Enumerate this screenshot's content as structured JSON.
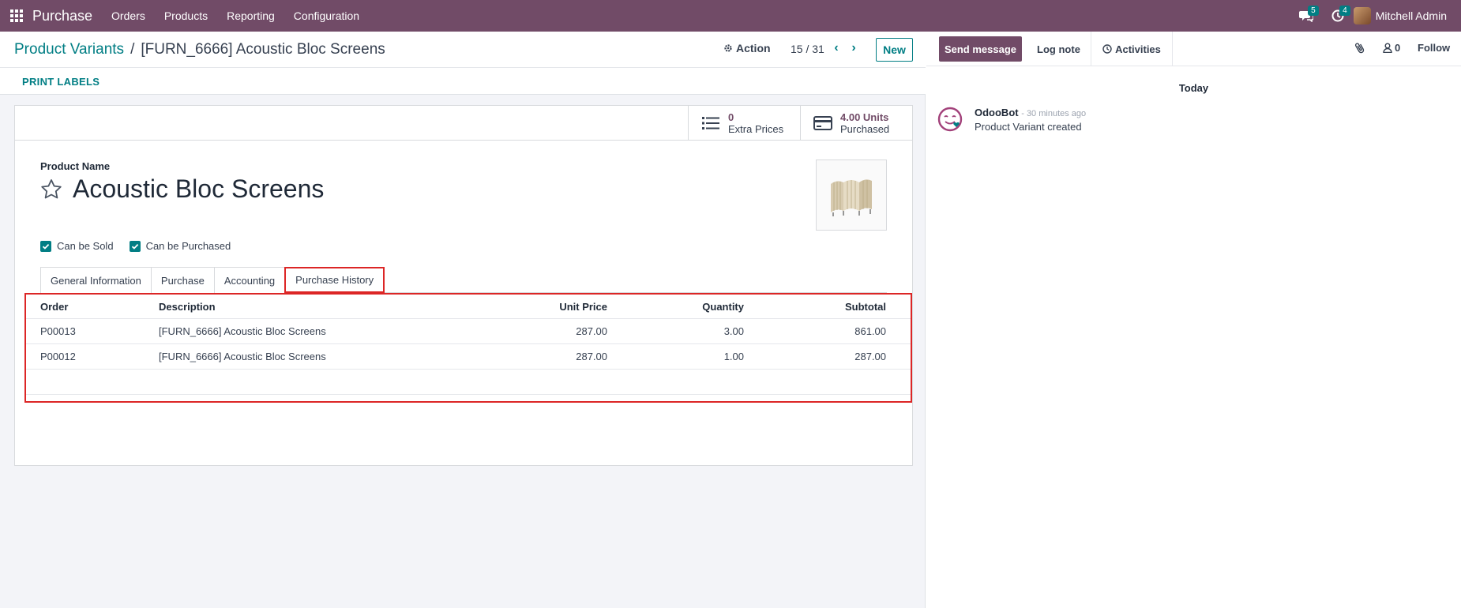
{
  "navbar": {
    "brand": "Purchase",
    "menu": [
      "Orders",
      "Products",
      "Reporting",
      "Configuration"
    ],
    "messages_count": "5",
    "activities_count": "4",
    "user": "Mitchell Admin"
  },
  "control_panel": {
    "breadcrumb_parent": "Product Variants",
    "breadcrumb_separator": "/",
    "breadcrumb_current": "[FURN_6666] Acoustic Bloc Screens",
    "action_label": "Action",
    "pager": "15 / 31",
    "new_label": "New"
  },
  "statusbar": {
    "print_labels": "PRINT LABELS"
  },
  "stat_buttons": {
    "extra_value": "0",
    "extra_label": "Extra Prices",
    "units_value": "4.00 Units",
    "units_label": "Purchased"
  },
  "product": {
    "name_label": "Product Name",
    "name": "Acoustic Bloc Screens",
    "can_be_sold": "Can be Sold",
    "can_be_purchased": "Can be Purchased"
  },
  "tabs": [
    "General Information",
    "Purchase",
    "Accounting",
    "Purchase History"
  ],
  "table": {
    "headers": {
      "order": "Order",
      "description": "Description",
      "unit_price": "Unit Price",
      "quantity": "Quantity",
      "subtotal": "Subtotal"
    },
    "rows": [
      {
        "order": "P00013",
        "description": "[FURN_6666] Acoustic Bloc Screens",
        "unit_price": "287.00",
        "quantity": "3.00",
        "subtotal": "861.00"
      },
      {
        "order": "P00012",
        "description": "[FURN_6666] Acoustic Bloc Screens",
        "unit_price": "287.00",
        "quantity": "1.00",
        "subtotal": "287.00"
      }
    ]
  },
  "chatter": {
    "send_message": "Send message",
    "log_note": "Log note",
    "activities": "Activities",
    "followers_count": "0",
    "follow": "Follow",
    "date_separator": "Today",
    "message": {
      "author": "OdooBot",
      "time": "- 30 minutes ago",
      "body": "Product Variant created"
    }
  },
  "colors": {
    "brand": "#714b67",
    "accent": "#017e84",
    "highlight": "#dc2626"
  }
}
